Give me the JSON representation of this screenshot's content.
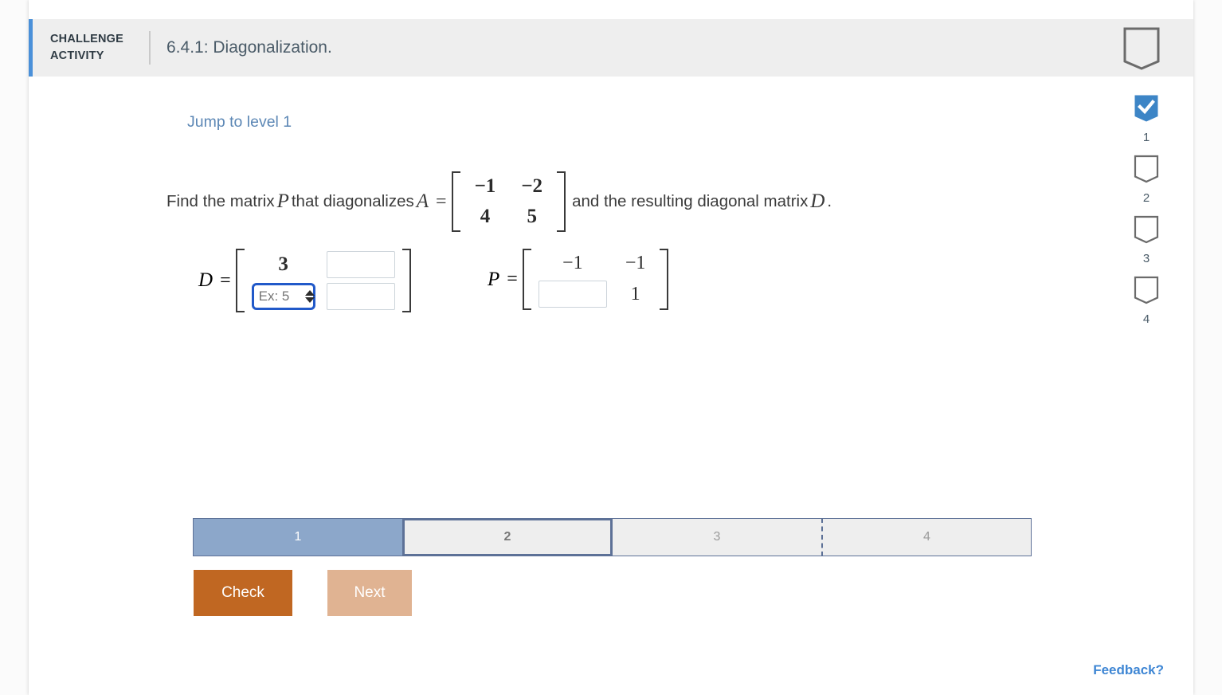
{
  "header": {
    "kicker_line1": "CHALLENGE",
    "kicker_line2": "ACTIVITY",
    "title": "6.4.1: Diagonalization.",
    "bookmark_icon": "bookmark-outline-icon",
    "accent_color": "#4a90d9",
    "background_color": "#eeeeee"
  },
  "content": {
    "jump_link": "Jump to level 1",
    "prompt": {
      "part1": "Find the matrix",
      "var_p": "P",
      "part2": "that diagonalizes",
      "var_a": "A",
      "equals": "=",
      "part3": "and the resulting diagonal matrix",
      "var_d": "D",
      "period": "."
    },
    "matrix_a": {
      "label": "A",
      "rows": [
        [
          "−1",
          "−2"
        ],
        [
          "4",
          "5"
        ]
      ]
    },
    "matrix_d": {
      "label": "D",
      "equals": "=",
      "cell_00": "3",
      "cell_01_value": "",
      "cell_10_value": "",
      "cell_10_placeholder": "Ex: 5",
      "cell_11_value": "",
      "focused_cell": "cell_10",
      "focus_border_color": "#2159c9"
    },
    "matrix_p": {
      "label": "P",
      "equals": "=",
      "cell_00": "−1",
      "cell_01": "−1",
      "cell_10_value": "",
      "cell_11": "1"
    }
  },
  "progress": {
    "segments": [
      {
        "label": "1",
        "state": "done"
      },
      {
        "label": "2",
        "state": "current"
      },
      {
        "label": "3",
        "state": "todo"
      },
      {
        "label": "4",
        "state": "todo"
      }
    ],
    "done_color": "#8ca7ca",
    "border_color": "#5d7197"
  },
  "actions": {
    "check_label": "Check",
    "check_color": "#c06722",
    "next_label": "Next",
    "next_color": "#e0b392"
  },
  "feedback": {
    "label": "Feedback?",
    "color": "#3e86d4"
  },
  "rail": {
    "items": [
      {
        "number": "1",
        "state": "complete",
        "icon": "bookmark-check-icon"
      },
      {
        "number": "2",
        "state": "incomplete",
        "icon": "bookmark-outline-icon"
      },
      {
        "number": "3",
        "state": "incomplete",
        "icon": "bookmark-outline-icon"
      },
      {
        "number": "4",
        "state": "incomplete",
        "icon": "bookmark-outline-icon"
      }
    ],
    "complete_color": "#3d85c6"
  }
}
